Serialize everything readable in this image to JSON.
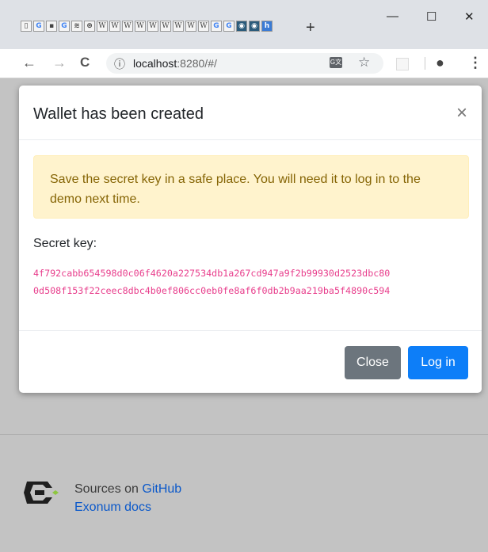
{
  "browser": {
    "tab_icons": [
      {
        "glyph": "▯",
        "style": ""
      },
      {
        "glyph": "G",
        "style": "g"
      },
      {
        "glyph": "▪",
        "style": ""
      },
      {
        "glyph": "G",
        "style": "g"
      },
      {
        "glyph": "≋",
        "style": ""
      },
      {
        "glyph": "⊛",
        "style": ""
      },
      {
        "glyph": "W",
        "style": "w"
      },
      {
        "glyph": "W",
        "style": "w"
      },
      {
        "glyph": "W",
        "style": "w"
      },
      {
        "glyph": "W",
        "style": "w"
      },
      {
        "glyph": "W",
        "style": "w"
      },
      {
        "glyph": "W",
        "style": "w"
      },
      {
        "glyph": "W",
        "style": "w"
      },
      {
        "glyph": "W",
        "style": "w"
      },
      {
        "glyph": "W",
        "style": "w"
      },
      {
        "glyph": "G",
        "style": "g"
      },
      {
        "glyph": "G",
        "style": "g"
      },
      {
        "glyph": "◉",
        "style": "dark"
      },
      {
        "glyph": "◉",
        "style": "dark"
      },
      {
        "glyph": "h",
        "style": "blue"
      }
    ],
    "new_tab": "+",
    "minimize": "—",
    "maximize": "☐",
    "close": "✕",
    "back": "←",
    "forward": "→",
    "reload": "C",
    "info_icon": "ⓘ",
    "url_host": "localhost",
    "url_path": ":8280/#/",
    "translate": "G文",
    "bookmark": "☆",
    "profile": "●",
    "menu": "⋮"
  },
  "modal": {
    "title": "Wallet has been created",
    "close_icon": "×",
    "alert_text": "Save the secret key in a safe place. You will need it to log in to the demo next time.",
    "secret_key_label": "Secret key:",
    "secret_key_line1": "4f792cabb654598d0c06f4620a227534db1a267cd947a9f2b99930d2523dbc80",
    "secret_key_line2": "0d508f153f22ceec8dbc4b0ef806cc0eb0fe8af6f0db2b9aa219ba5f4890c594",
    "close_button": "Close",
    "login_button": "Log in"
  },
  "footer": {
    "sources_prefix": "Sources on ",
    "github_link": "GitHub",
    "docs_link": "Exonum docs"
  },
  "colors": {
    "alert_bg": "#fff3cd",
    "alert_text": "#856404",
    "key_text": "#e83e8c",
    "primary": "#0d7ef8",
    "secondary": "#6c757d",
    "logo_accent": "#8dc63f"
  }
}
